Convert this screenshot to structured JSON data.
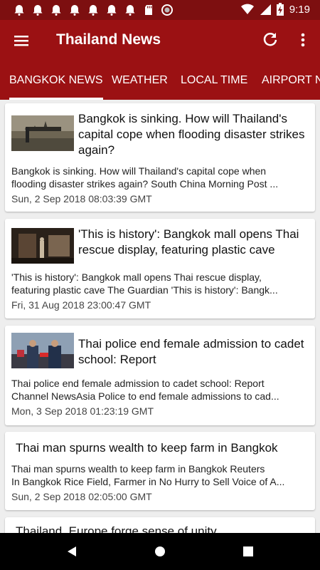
{
  "status": {
    "time": "9:19"
  },
  "app": {
    "title": "Thailand News"
  },
  "tabs": [
    "BANGKOK NEWS",
    "WEATHER",
    "LOCAL TIME",
    "AIRPORT NE"
  ],
  "articles": [
    {
      "headline": "Bangkok is sinking. How will Thailand's capital cope when flooding disaster strikes again?",
      "desc1": "Bangkok is sinking. How will Thailand's capital cope when",
      "desc2": "flooding disaster strikes again?  South China Morning Post  ...",
      "date": "Sun, 2 Sep 2018 08:03:39 GMT"
    },
    {
      "headline": "'This is history': Bangkok mall opens Thai rescue display, featuring plastic cave",
      "desc1": "'This is history': Bangkok mall opens Thai rescue display,",
      "desc2": "featuring plastic cave  The Guardian  'This is history': Bangk...",
      "date": "Fri, 31 Aug 2018 23:00:47 GMT"
    },
    {
      "headline": "Thai police end female admission to cadet school: Report",
      "desc1": "Thai police end female admission to cadet school: Report",
      "desc2": "Channel NewsAsia  Police to end female admissions to cad...",
      "date": "Mon, 3 Sep 2018 01:23:19 GMT"
    },
    {
      "headline": "Thai man spurns wealth to keep farm in Bangkok",
      "desc1": "Thai man spurns wealth to keep farm in Bangkok  Reuters",
      "desc2": "In Bangkok Rice Field, Farmer in No Hurry to Sell  Voice of A...",
      "date": "Sun, 2 Sep 2018 02:05:00 GMT"
    },
    {
      "headline": "Thailand, Europe forge sense of unity"
    }
  ],
  "colors": {
    "primary": "#9b1113",
    "statusbar": "#7d0f10"
  },
  "icons": [
    "menu-icon",
    "refresh-icon",
    "more-vert-icon",
    "back-icon",
    "home-icon",
    "recents-icon"
  ]
}
